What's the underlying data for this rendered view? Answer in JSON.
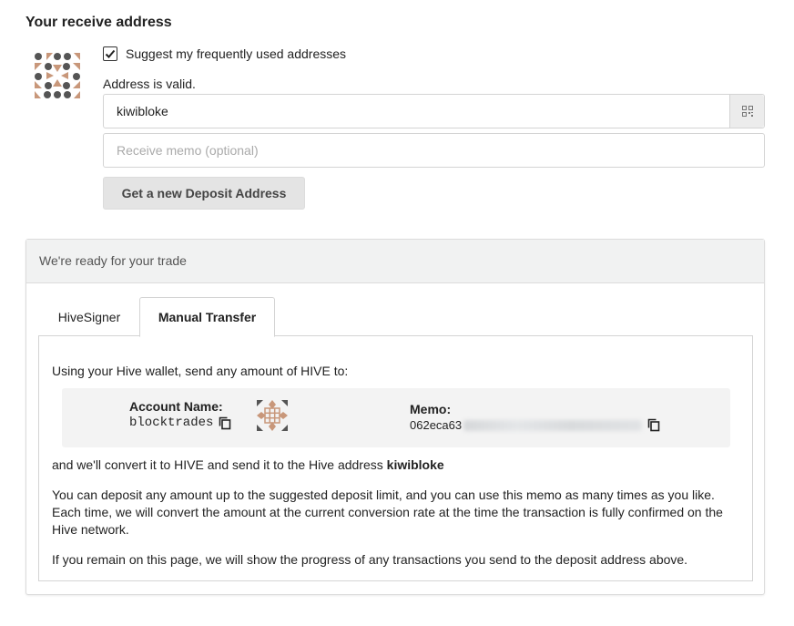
{
  "receive": {
    "title": "Your receive address",
    "suggest_label": "Suggest my frequently used addresses",
    "suggest_checked": true,
    "valid_text": "Address is valid.",
    "address_value": "kiwibloke",
    "memo_placeholder": "Receive memo (optional)",
    "deposit_button": "Get a new Deposit Address"
  },
  "panel": {
    "header": "We're ready for your trade",
    "tabs": [
      {
        "label": "HiveSigner",
        "active": false
      },
      {
        "label": "Manual Transfer",
        "active": true
      }
    ],
    "intro": "Using your Hive wallet, send any amount of HIVE to:",
    "account_label": "Account Name:",
    "account_value": "blocktrades",
    "memo_label": "Memo:",
    "memo_value_visible": "062eca63",
    "convert_text": "and we'll convert it to HIVE and send it to the Hive address ",
    "convert_address": "kiwibloke",
    "deposit_info": "You can deposit any amount up to the suggested deposit limit, and you can use this memo as many times as you like. Each time, we will convert the amount at the current conversion rate at the time the transaction is fully confirmed on the Hive network.",
    "progress_info": "If you remain on this page, we will show the progress of any transactions you send to the deposit address above."
  },
  "icons": {
    "identicon": "identicon-icon",
    "qr": "qr-code-icon",
    "copy": "copy-icon",
    "checkbox": "checkmark-icon"
  },
  "colors": {
    "identicon_dark": "#555555",
    "identicon_brown": "#c8977a",
    "panel_header_bg": "#f1f2f2",
    "button_bg": "#e4e4e4"
  }
}
